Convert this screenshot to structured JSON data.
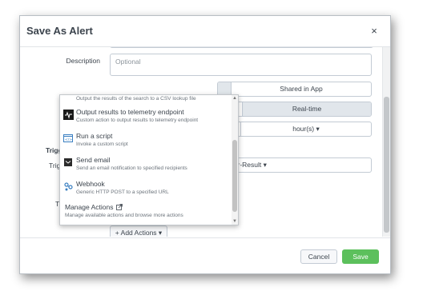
{
  "dialog": {
    "title": "Save As Alert",
    "close_symbol": "×"
  },
  "form": {
    "description_label": "Description",
    "description_placeholder": "Optional",
    "permissions_selected": "Shared in App",
    "alert_type_selected": "Real-time",
    "time_unit": "hour(s) ▾",
    "trigger_label_bold": "Trigg",
    "trigger_label_normal": "Trig",
    "trigger_value": "Per-Result ▾",
    "t_label": "T",
    "add_actions": "+ Add Actions ▾"
  },
  "actions_menu": {
    "items": [
      {
        "title": "",
        "description": "Output the results of the search to a CSV lookup file",
        "icon": "csv-icon"
      },
      {
        "title": "Output results to telemetry endpoint",
        "description": "Custom action to output results to telemetry endpoint",
        "icon": "telemetry-icon"
      },
      {
        "title": "Run a script",
        "description": "Invoke a custom script",
        "icon": "script-icon"
      },
      {
        "title": "Send email",
        "description": "Send an email notification to specified recipients",
        "icon": "email-icon"
      },
      {
        "title": "Webhook",
        "description": "Generic HTTP POST to a specified URL",
        "icon": "webhook-icon"
      }
    ],
    "manage_title": "Manage Actions",
    "manage_description": "Manage available actions and browse more actions"
  },
  "footer": {
    "cancel": "Cancel",
    "save": "Save"
  },
  "colors": {
    "save_green": "#5cc05c",
    "active_segment": "#e1e6eb"
  }
}
